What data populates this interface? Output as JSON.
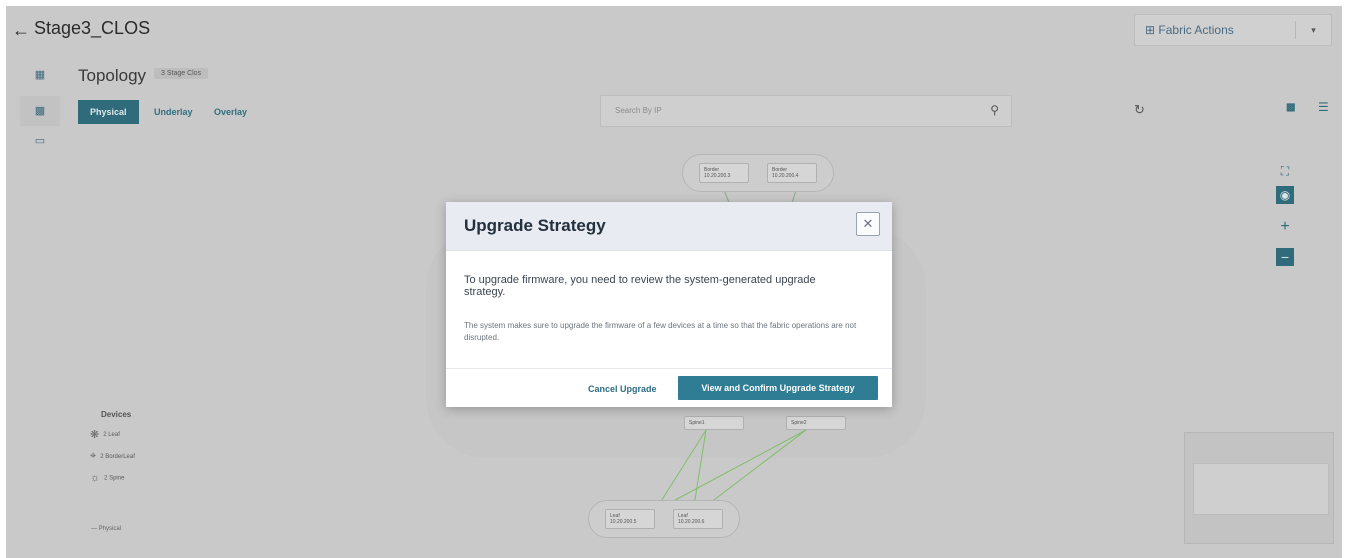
{
  "header": {
    "back_icon": "arrow-left-icon",
    "title": "Stage3_CLOS",
    "fabric_actions_label": "⊞ Fabric Actions",
    "fabric_actions_caret": "▾"
  },
  "topology": {
    "title": "Topology",
    "badge": "3 Stage Clos",
    "tabs": [
      {
        "label": "Physical",
        "active": true
      },
      {
        "label": "Underlay",
        "active": false
      },
      {
        "label": "Overlay",
        "active": false
      }
    ],
    "search_placeholder": "Search By IP",
    "nodes": {
      "border_1_label": "Border",
      "border_1_ip": "10.20.200.3",
      "border_2_label": "Border",
      "border_2_ip": "10.20.200.4",
      "spine_1_label": "Spine1",
      "spine_2_label": "Spine2",
      "leaf_1_label": "Leaf",
      "leaf_1_ip": "10.20.200.5",
      "leaf_2_label": "Leaf",
      "leaf_2_ip": "10.20.200.6"
    }
  },
  "legend": {
    "title": "Devices",
    "items": [
      {
        "icon": "leaf-icon",
        "label": "2 Leaf"
      },
      {
        "icon": "border-leaf-icon",
        "label": "2 BorderLeaf"
      },
      {
        "icon": "spine-icon",
        "label": "2 Spine"
      }
    ],
    "physical_label": "— Physical"
  },
  "modal": {
    "title": "Upgrade Strategy",
    "message": "To upgrade firmware, you need to review the system-generated upgrade strategy.",
    "note": "The system makes sure to upgrade the firmware of a few devices at a time so that the fabric operations are not disrupted.",
    "cancel_label": "Cancel Upgrade",
    "confirm_label": "View and Confirm Upgrade Strategy"
  },
  "colors": {
    "primary": "#2f7c95",
    "overlay_background": "#c9c9c9",
    "modal_header": "#e8ebf1",
    "link_line": "#7fbf6a"
  }
}
